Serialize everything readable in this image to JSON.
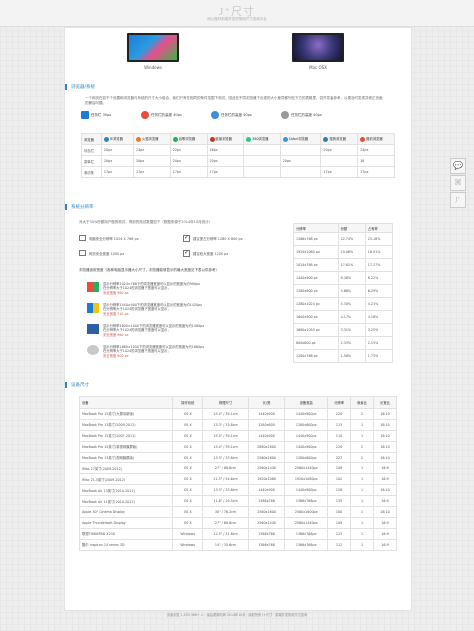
{
  "header": {
    "logo": "J⁺尺寸",
    "subtitle": "用心做好前端开发的常用尺寸查询平台"
  },
  "devices": [
    {
      "label": "Windows"
    },
    {
      "label": "Mac OSX"
    }
  ],
  "browser_section": {
    "title": "浏览器/系统",
    "desc": "一个网页在若干个设置和浏览器与系统的尺寸大小组合，我们只有在相同的条件范围下测试，因此在不同浏览器下出现的大小差异都列在下方的表格里，供开发者参考，以便及时发现并修正页面的兼容问题。",
    "os_pills": [
      {
        "label": "任务栏 30px",
        "color": "#1f7ad6"
      },
      {
        "label": "任务栏的高度 40px",
        "color": "#e84c3d"
      },
      {
        "label": "任务栏的高度 40px",
        "color": "#3b8fd8"
      },
      {
        "label": "任务栏的高度 40px",
        "color": "#999999"
      }
    ],
    "headers": [
      "浏览器",
      "IE浏览器",
      "火狐浏览器",
      "谷歌浏览器",
      "欧朋浏览器",
      "360浏览器",
      "Safari浏览器",
      "搜狗浏览器",
      "猎豹浏览器"
    ],
    "rows": [
      [
        "状态栏",
        "20px",
        "24px",
        "22px",
        "26px",
        "",
        "",
        "20px",
        "24px"
      ],
      [
        "菜单栏",
        "20px",
        "20px",
        "20px",
        "20px",
        "",
        "20px",
        "",
        "16"
      ],
      [
        "滚动条",
        "17px",
        "17px",
        "17px",
        "17px",
        "",
        "",
        "17px",
        "17px"
      ]
    ]
  },
  "resolution_section": {
    "title": "系统分辨率",
    "desc": "对大于30%份额用户做的测试，得到的测试数据如下（数据来源于2014年10月统计）",
    "checks": [
      {
        "label": "电脑安全分辨率 1024 X 768 px",
        "checked": false
      },
      {
        "label": "建议宽左分辨率 1280 X 800 px",
        "checked": true
      },
      {
        "label": "网页安全宽度 1000 px",
        "checked": false
      },
      {
        "label": "建议较大宽度 1200 px",
        "checked": true
      }
    ],
    "note": "浏览器适用宽度（各种电脑显示器大小尺寸，浏览器能够显示的最大宽度见下表以供参考）",
    "os_notes": [
      {
        "os": "Windows XP",
        "logo_color": "#3d8b2e",
        "lines": [
          "显示分辨率1024×768下的浏览器宽度可以显示的宽度为约990px",
          "在分辨率大于1024的浏览器下宽度可以显示，",
          "安全宽度 960 px"
        ]
      },
      {
        "os": "Windows 7",
        "logo_color": "#1f7ad6",
        "lines": [
          "显示分辨率1440×900下的浏览器宽度可以显示的宽度为约1420px",
          "在分辨率大于1024的浏览器下宽度可以显示，",
          "安全宽度 710 px"
        ]
      },
      {
        "os": "Windows 8",
        "logo_color": "#2b5fa8",
        "lines": [
          "显示分辨率1600×1000下的浏览器宽度可以显示的宽度为约1580px",
          "在分辨率大于1024的浏览器下宽度可以显示，",
          "安全宽度 960 px"
        ]
      },
      {
        "os": "Mac OS X",
        "logo_color": "#aaaaaa",
        "lines": [
          "显示分辨率1680×1050下的浏览器宽度可以显示的宽度为约1660px",
          "在分辨率大于1024的浏览器下宽度可以显示，",
          "安全宽度 900 px"
        ]
      }
    ],
    "table": {
      "headers": [
        "分辨率",
        "份额",
        "占有率"
      ],
      "rows": [
        [
          "1366x768 px",
          "22.74%",
          "23.18%"
        ],
        [
          "1920x1080 px",
          "19.06%",
          "18.91%"
        ],
        [
          "1024x768 px",
          "17.61%",
          "17.17%"
        ],
        [
          "1440x900 px",
          "8.38%",
          "8.22%"
        ],
        [
          "1280x800 px",
          "5.66%",
          "6.29%"
        ],
        [
          "1280x1024 px",
          "4.30%",
          "4.21%"
        ],
        [
          "1600x900 px",
          "4.17%",
          "4.18%"
        ],
        [
          "1680x1050 px",
          "3.31%",
          "3.25%"
        ],
        [
          "800x600 px",
          "2.33%",
          "2.15%"
        ],
        [
          "1280x768 px",
          "1.56%",
          "1.73%"
        ]
      ]
    }
  },
  "device_section": {
    "title": "设备尺寸",
    "headers": [
      "设备",
      "操作系统",
      "物理尺寸",
      "长/宽",
      "设备宽高",
      "分辨率",
      "像素比",
      "长宽比"
    ],
    "rows": [
      [
        "MacBook Pro 15英寸(大屏诉新版)",
        "OS X",
        "15.4\" / 39.1cm",
        "1440x900",
        "1440x900px",
        "220",
        "2",
        "16:10"
      ],
      [
        "MacBook Pro 13英寸(2009-2012)",
        "OS X",
        "13.3\" / 33.8cm",
        "1280x800",
        "1280x800px",
        "113",
        "1",
        "16:10"
      ],
      [
        "MacBook Pro 15英寸(2007-2011)",
        "OS X",
        "15.4\" / 39.1cm",
        "1440x900",
        "1440x900px",
        "110",
        "1",
        "16:10"
      ],
      [
        "MacBook Pro 15英寸(新视网膜屏版)",
        "OS X",
        "15.4\" / 39.1cm",
        "2880x1800",
        "1440x900px",
        "220",
        "2",
        "16:10"
      ],
      [
        "MacBook Pro 13英寸(视网膜屏版)",
        "OS X",
        "13.3\" / 33.8cm",
        "2560x1600",
        "1280x800px",
        "227",
        "2",
        "16:10"
      ],
      [
        "iMac 27英寸(2009-2012)",
        "OS X",
        "27\" / 68.6cm",
        "2560x1440",
        "2560x1440px",
        "109",
        "1",
        "16:9"
      ],
      [
        "iMac 21.5英寸(2009-2012)",
        "OS X",
        "21.5\" / 54.6cm",
        "1920x1080",
        "1920x1080px",
        "102",
        "1",
        "16:9"
      ],
      [
        "MacBook Air 13英寸(2010-2012)",
        "OS X",
        "13.3\" / 33.8cm",
        "1440x900",
        "1440x900px",
        "128",
        "1",
        "16:10"
      ],
      [
        "MacBook Air 11英寸(2010-2012)",
        "OS X",
        "11.6\" / 29.5cm",
        "1366x768",
        "1366x768px",
        "135",
        "1",
        "16:9"
      ],
      [
        "Apple 30\" Cinema Display",
        "OS X",
        "30\" / 76.2cm",
        "2560x1600",
        "2560x1600px",
        "100",
        "1",
        "16:10"
      ],
      [
        "Apple Thunderbolt Display",
        "OS X",
        "27\" / 68.6cm",
        "2560x1440",
        "2560x1440px",
        "109",
        "1",
        "16:9"
      ],
      [
        "联想THINKPAD X230",
        "Windows",
        "12.5\" / 31.8cm",
        "1366x768",
        "1366x768px",
        "125",
        "1",
        "16:9"
      ],
      [
        "戴尔 Inspiron 14 series 3D",
        "Windows",
        "14\" / 35.6cm",
        "1366x768",
        "1366x768px",
        "112",
        "1",
        "16:9"
      ]
    ]
  },
  "footer": "页面浏览 1,450,366+ 人 · 最后更新时间 2014年10月 · 版权所有 J+尺寸 · 前端开发常用尺寸查询",
  "side_buttons": [
    {
      "glyph": "💬"
    },
    {
      "glyph": "⌘"
    },
    {
      "glyph": "J⁺"
    }
  ]
}
